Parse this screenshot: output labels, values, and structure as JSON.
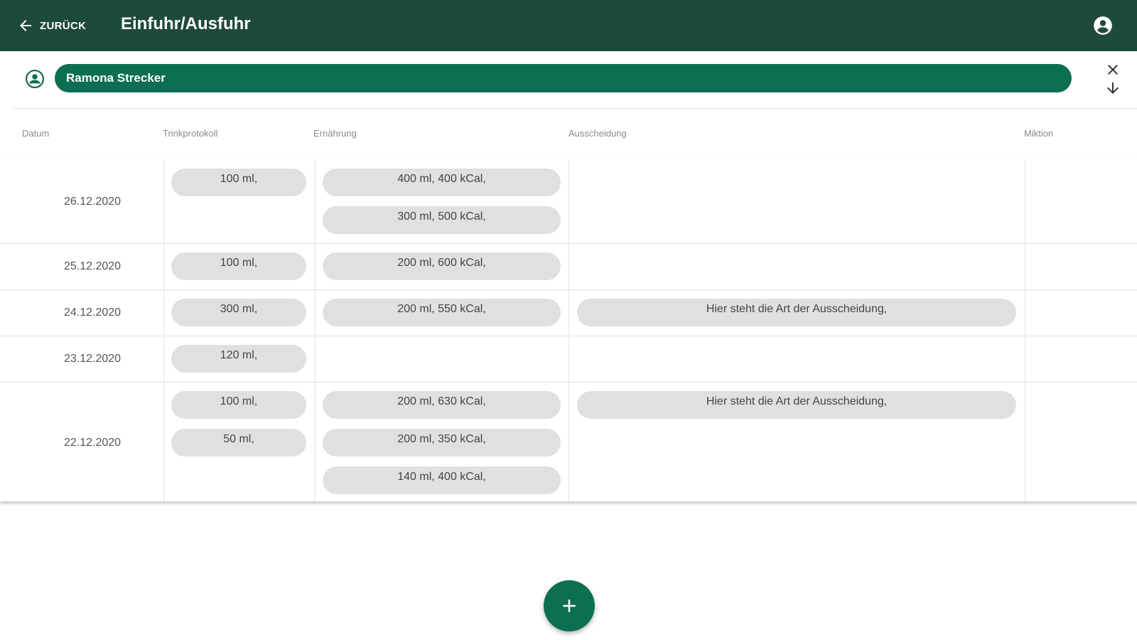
{
  "header": {
    "back_label": "ZURÜCK",
    "title": "Einfuhr/Ausfuhr",
    "back_icon": "arrow-left-icon",
    "account_icon": "account-circle-icon",
    "bg_color": "#1e4a3b"
  },
  "patient": {
    "name": "Ramona Strecker",
    "icon": "person-icon",
    "chip_color": "#0c6e52",
    "close_icon": "close-icon",
    "sort_icon": "arrow-down-icon"
  },
  "table": {
    "headers": {
      "date": "Datum",
      "trink": "Trinkprotokoll",
      "ern": "Ernährung",
      "aus": "Ausscheidung",
      "mik": "Miktion"
    },
    "rows": [
      {
        "date": "26.12.2020",
        "trink": [
          "100 ml,"
        ],
        "ern": [
          "400 ml, 400 kCal,",
          "300 ml, 500 kCal,"
        ],
        "aus": []
      },
      {
        "date": "25.12.2020",
        "trink": [
          "100 ml,"
        ],
        "ern": [
          "200 ml, 600 kCal,"
        ],
        "aus": []
      },
      {
        "date": "24.12.2020",
        "trink": [
          "300 ml,"
        ],
        "ern": [
          "200 ml, 550 kCal,"
        ],
        "aus": [
          "Hier steht die Art der Ausscheidung,"
        ]
      },
      {
        "date": "23.12.2020",
        "trink": [
          "120 ml,"
        ],
        "ern": [],
        "aus": []
      },
      {
        "date": "22.12.2020",
        "trink": [
          "100 ml,",
          "50 ml,"
        ],
        "ern": [
          "200 ml, 630 kCal,",
          "200 ml, 350 kCal,",
          "140 ml, 400 kCal,"
        ],
        "aus": [
          "Hier steht die Art der Ausscheidung,"
        ]
      }
    ]
  },
  "fab": {
    "icon": "plus-icon"
  }
}
